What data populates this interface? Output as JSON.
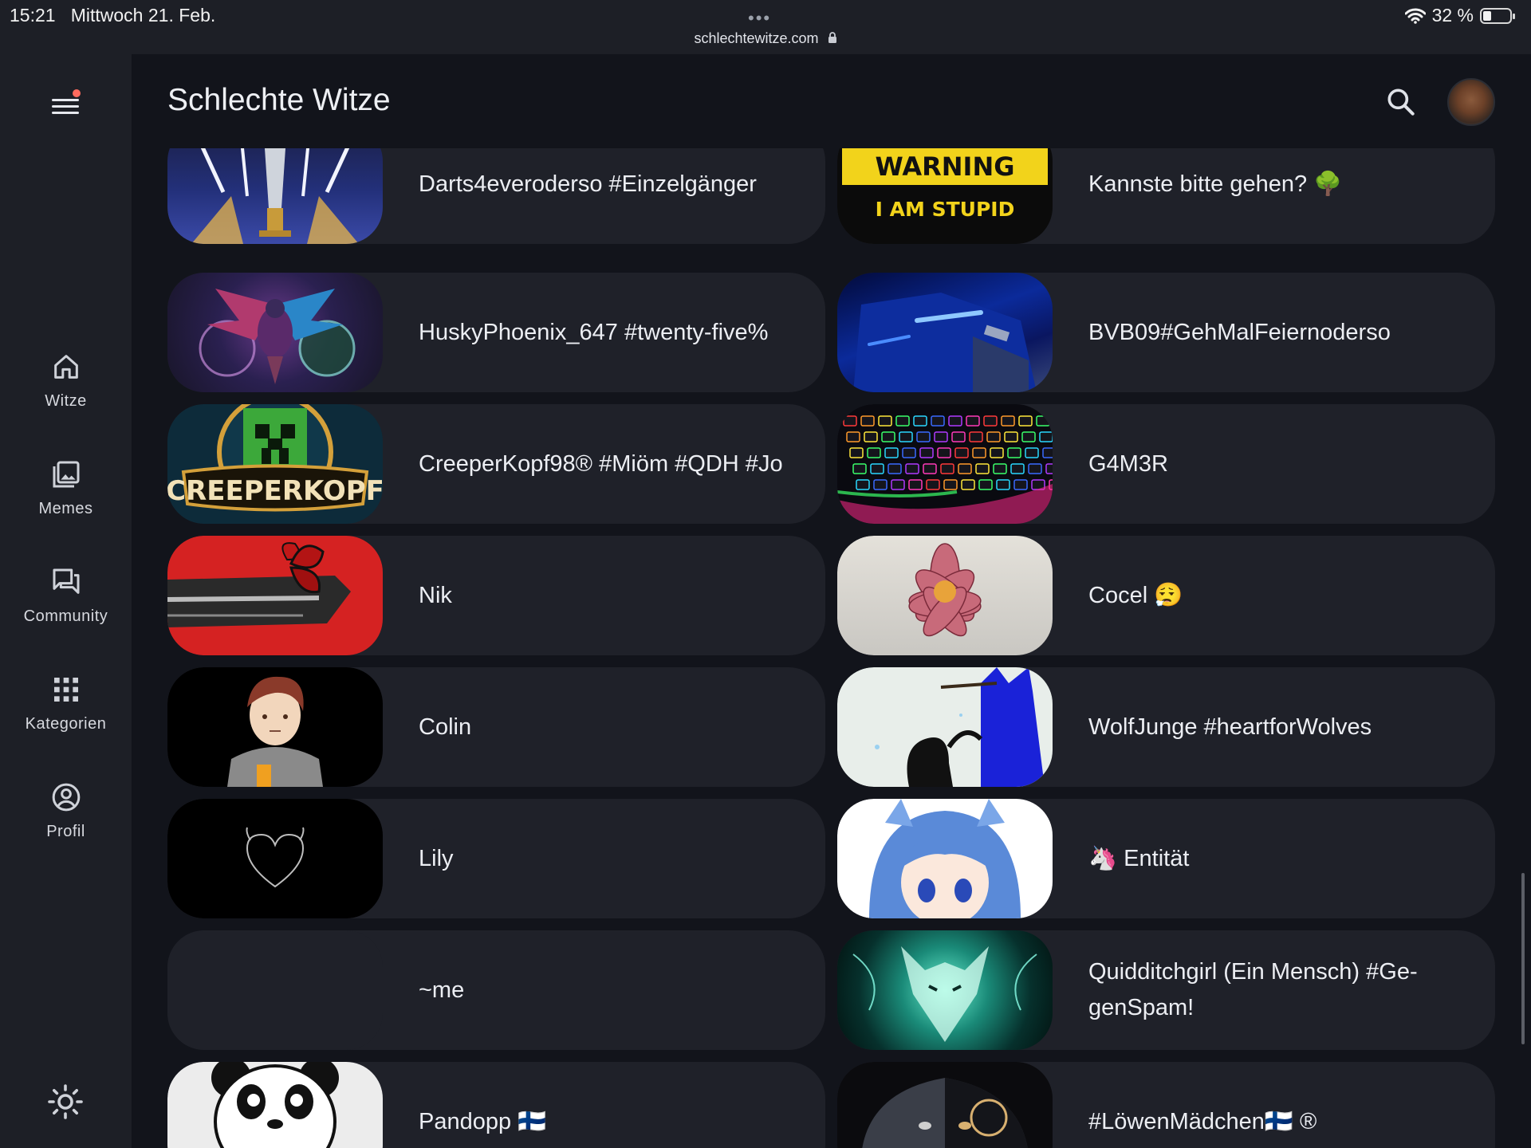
{
  "status_bar": {
    "time": "15:21",
    "date": "Mittwoch 21. Feb.",
    "dots": "•••",
    "url": "schlechtewitze.com",
    "lock_icon": "lock-icon",
    "wifi_icon": "wifi-icon",
    "battery_text": "32 %",
    "battery_level": 0.32
  },
  "sidebar": {
    "menu_icon": "menu-icon",
    "items": [
      {
        "label": "Witze",
        "icon": "home-icon"
      },
      {
        "label": "Memes",
        "icon": "gallery-icon"
      },
      {
        "label": "Community",
        "icon": "forum-icon"
      },
      {
        "label": "Kategorien",
        "icon": "grid-icon"
      },
      {
        "label": "Profil",
        "icon": "account-icon"
      }
    ],
    "theme_icon": "sun-icon"
  },
  "header": {
    "title": "Schlechte Witze",
    "search_icon": "search-icon"
  },
  "profiles": [
    {
      "name": "Darts4everoderso #Einzelgänger",
      "thumb": "darts-trophy"
    },
    {
      "name": "Kannste bitte gehen? 🌳",
      "thumb": "warning-sign",
      "thumb_text_top": "WARNING",
      "thumb_text_bottom": "I AM STUPID"
    },
    {
      "name": "HuskyPhoenix_647 #twenty-five%",
      "thumb": "phoenix"
    },
    {
      "name": "BVB09#GehMalFeiernoderso",
      "thumb": "blue-motorbike"
    },
    {
      "name": "CreeperKopf98® #Miöm #QDH #Jo",
      "thumb": "creeper-logo",
      "thumb_text": "CREEPERKOPF"
    },
    {
      "name": "G4M3R",
      "thumb": "rgb-keyboard"
    },
    {
      "name": "Nik",
      "thumb": "red-butterfly"
    },
    {
      "name": "Cocel 😮‍💨",
      "thumb": "pink-flower"
    },
    {
      "name": "Colin",
      "thumb": "anime-boy"
    },
    {
      "name": "WolfJunge #heartforWolves",
      "thumb": "blue-wolf"
    },
    {
      "name": "Lily",
      "thumb": "devil-heart"
    },
    {
      "name": "🦄 Entität",
      "thumb": "anime-girl"
    },
    {
      "name": "~me",
      "thumb": "none"
    },
    {
      "name": "Quidditchgirl (Ein Mensch) #Ge-genSpam!",
      "thumb": "glowing-wolf"
    },
    {
      "name": "Pandopp 🇫🇮",
      "thumb": "panda"
    },
    {
      "name": "#LöwenMädchen🇫🇮 ®",
      "thumb": "lion"
    }
  ]
}
